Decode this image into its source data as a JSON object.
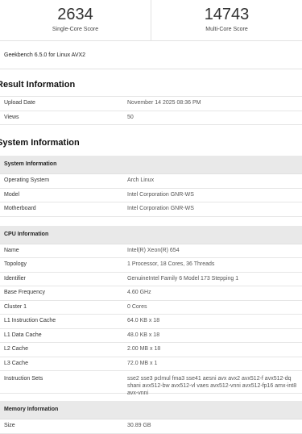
{
  "scores": {
    "single": {
      "value": "2634",
      "label": "Single-Core Score"
    },
    "multi": {
      "value": "14743",
      "label": "Multi-Core Score"
    }
  },
  "version": "Geekbench 6.5.0 for Linux AVX2",
  "result_info": {
    "title": "Result Information",
    "rows": [
      {
        "key": "Upload Date",
        "value": "November 14 2025 08:36 PM"
      },
      {
        "key": "Views",
        "value": "50"
      }
    ]
  },
  "system_info": {
    "title": "System Information",
    "system": {
      "header": "System Information",
      "rows": [
        {
          "key": "Operating System",
          "value": "Arch Linux"
        },
        {
          "key": "Model",
          "value": "Intel Corporation GNR-WS"
        },
        {
          "key": "Motherboard",
          "value": "Intel Corporation GNR-WS"
        }
      ]
    },
    "cpu": {
      "header": "CPU Information",
      "rows": [
        {
          "key": "Name",
          "value": "Intel(R) Xeon(R) 654"
        },
        {
          "key": "Topology",
          "value": "1 Processor, 18 Cores, 36 Threads"
        },
        {
          "key": "Identifier",
          "value": "GenuineIntel Family 6 Model 173 Stepping 1"
        },
        {
          "key": "Base Frequency",
          "value": "4.60 GHz"
        },
        {
          "key": "Cluster 1",
          "value": "0 Cores"
        },
        {
          "key": "L1 Instruction Cache",
          "value": "64.0 KB x 18"
        },
        {
          "key": "L1 Data Cache",
          "value": "48.0 KB x 18"
        },
        {
          "key": "L2 Cache",
          "value": "2.00 MB x 18"
        },
        {
          "key": "L3 Cache",
          "value": "72.0 MB x 1"
        },
        {
          "key": "Instruction Sets",
          "value": "sse2 sse3 pclmul fma3 sse41 aesni avx avx2 avx512-f avx512-dq shani avx512-bw avx512-vl vaes avx512-vnni avx512-fp16 amx-int8 avx-vnni"
        }
      ]
    },
    "memory": {
      "header": "Memory Information",
      "rows": [
        {
          "key": "Size",
          "value": "30.89 GB"
        }
      ]
    }
  }
}
